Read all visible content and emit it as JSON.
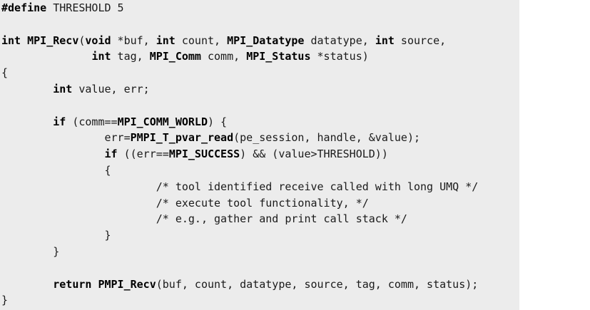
{
  "code": {
    "lines": [
      [
        {
          "t": "#define",
          "k": "kw"
        },
        {
          "t": " THRESHOLD 5",
          "k": "tx"
        }
      ],
      [],
      [
        {
          "t": "int",
          "k": "kw"
        },
        {
          "t": " ",
          "k": "tx"
        },
        {
          "t": "MPI_Recv",
          "k": "kw"
        },
        {
          "t": "(",
          "k": "tx"
        },
        {
          "t": "void",
          "k": "kw"
        },
        {
          "t": " *buf, ",
          "k": "tx"
        },
        {
          "t": "int",
          "k": "kw"
        },
        {
          "t": " count, ",
          "k": "tx"
        },
        {
          "t": "MPI_Datatype",
          "k": "kw"
        },
        {
          "t": " datatype, ",
          "k": "tx"
        },
        {
          "t": "int",
          "k": "kw"
        },
        {
          "t": " source,",
          "k": "tx"
        }
      ],
      [
        {
          "t": "              ",
          "k": "tx"
        },
        {
          "t": "int",
          "k": "kw"
        },
        {
          "t": " tag, ",
          "k": "tx"
        },
        {
          "t": "MPI_Comm",
          "k": "kw"
        },
        {
          "t": " comm, ",
          "k": "tx"
        },
        {
          "t": "MPI_Status",
          "k": "kw"
        },
        {
          "t": " *status)",
          "k": "tx"
        }
      ],
      [
        {
          "t": "{",
          "k": "tx"
        }
      ],
      [
        {
          "t": "        ",
          "k": "tx"
        },
        {
          "t": "int",
          "k": "kw"
        },
        {
          "t": " value, err;",
          "k": "tx"
        }
      ],
      [],
      [
        {
          "t": "        ",
          "k": "tx"
        },
        {
          "t": "if",
          "k": "kw"
        },
        {
          "t": " (comm==",
          "k": "tx"
        },
        {
          "t": "MPI_COMM_WORLD",
          "k": "kw"
        },
        {
          "t": ") {",
          "k": "tx"
        }
      ],
      [
        {
          "t": "                err=",
          "k": "tx"
        },
        {
          "t": "PMPI_T_pvar_read",
          "k": "kw"
        },
        {
          "t": "(pe_session, handle, &value);",
          "k": "tx"
        }
      ],
      [
        {
          "t": "                ",
          "k": "tx"
        },
        {
          "t": "if",
          "k": "kw"
        },
        {
          "t": " ((err==",
          "k": "tx"
        },
        {
          "t": "MPI_SUCCESS",
          "k": "kw"
        },
        {
          "t": ") && (value>THRESHOLD))",
          "k": "tx"
        }
      ],
      [
        {
          "t": "                {",
          "k": "tx"
        }
      ],
      [
        {
          "t": "                        ",
          "k": "tx"
        },
        {
          "t": "/* tool identified receive called with long UMQ */",
          "k": "cm"
        }
      ],
      [
        {
          "t": "                        ",
          "k": "tx"
        },
        {
          "t": "/* execute tool functionality, */",
          "k": "cm"
        }
      ],
      [
        {
          "t": "                        ",
          "k": "tx"
        },
        {
          "t": "/* e.g., gather and print call stack */",
          "k": "cm"
        }
      ],
      [
        {
          "t": "                }",
          "k": "tx"
        }
      ],
      [
        {
          "t": "        }",
          "k": "tx"
        }
      ],
      [],
      [
        {
          "t": "        ",
          "k": "tx"
        },
        {
          "t": "return",
          "k": "kw"
        },
        {
          "t": " ",
          "k": "tx"
        },
        {
          "t": "PMPI_Recv",
          "k": "kw"
        },
        {
          "t": "(buf, count, datatype, source, tag, comm, status);",
          "k": "tx"
        }
      ],
      [
        {
          "t": "}",
          "k": "tx"
        }
      ]
    ]
  }
}
